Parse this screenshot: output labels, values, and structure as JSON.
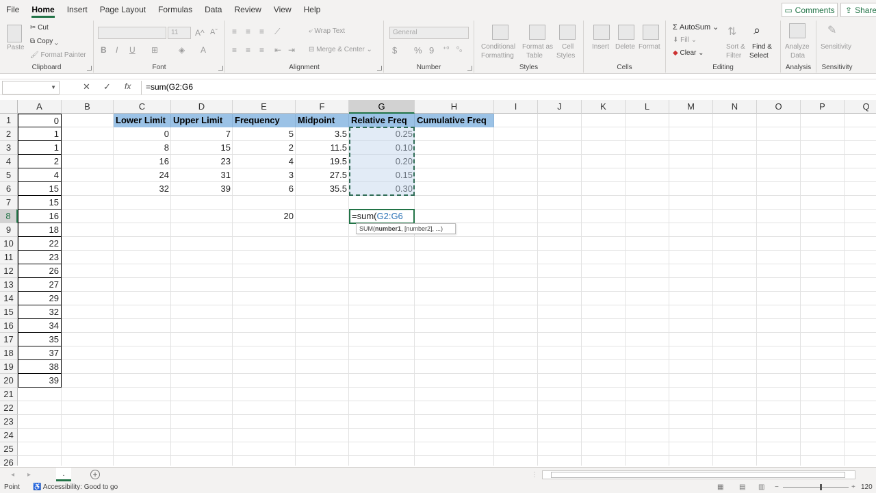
{
  "menu": {
    "tabs": [
      "File",
      "Home",
      "Insert",
      "Page Layout",
      "Formulas",
      "Data",
      "Review",
      "View",
      "Help"
    ],
    "active": "Home",
    "comments_label": "Comments",
    "share_label": "Share"
  },
  "ribbon": {
    "clipboard": {
      "label": "Clipboard",
      "paste": "Paste",
      "cut": "Cut",
      "copy": "Copy",
      "format_painter": "Format Painter"
    },
    "font": {
      "label": "Font",
      "size": "11",
      "bold": "B",
      "italic": "I",
      "underline": "U"
    },
    "alignment": {
      "label": "Alignment",
      "wrap": "Wrap Text",
      "merge": "Merge & Center"
    },
    "number": {
      "label": "Number",
      "format": "General",
      "currency": "$",
      "percent": "%",
      "comma": "9"
    },
    "styles": {
      "label": "Styles",
      "conditional": "Conditional",
      "formatting": "Formatting",
      "format_as": "Format as",
      "table": "Table",
      "cell": "Cell",
      "cell_styles": "Styles"
    },
    "cells": {
      "label": "Cells",
      "insert": "Insert",
      "delete": "Delete",
      "format": "Format"
    },
    "editing": {
      "label": "Editing",
      "autosum": "AutoSum",
      "fill": "Fill",
      "clear": "Clear",
      "sort": "Sort &",
      "filter": "Filter",
      "find": "Find &",
      "select": "Select"
    },
    "analysis": {
      "label": "Analysis",
      "analyze": "Analyze",
      "data": "Data"
    },
    "sensitivity": {
      "label": "Sensitivity",
      "name": "Sensitivity"
    }
  },
  "formula_bar": {
    "cancel": "✕",
    "enter": "✓",
    "fx": "fx",
    "content": "=sum(G2:G6"
  },
  "columns": [
    "A",
    "B",
    "C",
    "D",
    "E",
    "F",
    "G",
    "H",
    "I",
    "J",
    "K",
    "L",
    "M",
    "N",
    "O",
    "P",
    "Q"
  ],
  "rows": [
    "1",
    "2",
    "3",
    "4",
    "5",
    "6",
    "7",
    "8",
    "9",
    "10",
    "11",
    "12",
    "13",
    "14",
    "15",
    "16",
    "17",
    "18",
    "19",
    "20",
    "21",
    "22",
    "23",
    "24",
    "25",
    "26"
  ],
  "col_a": [
    "0",
    "1",
    "1",
    "2",
    "4",
    "15",
    "15",
    "16",
    "18",
    "22",
    "23",
    "26",
    "27",
    "29",
    "32",
    "34",
    "35",
    "37",
    "38",
    "39"
  ],
  "table": {
    "headers": [
      "Lower Limit",
      "Upper Limit",
      "Frequency",
      "Midpoint",
      "Relative Freq",
      "Cumulative Freq"
    ],
    "rows": [
      [
        "0",
        "7",
        "5",
        "3.5",
        "0.25"
      ],
      [
        "8",
        "15",
        "2",
        "11.5",
        "0.10"
      ],
      [
        "16",
        "23",
        "4",
        "19.5",
        "0.20"
      ],
      [
        "24",
        "31",
        "3",
        "27.5",
        "0.15"
      ],
      [
        "32",
        "39",
        "6",
        "35.5",
        "0.30"
      ]
    ],
    "freq_total": "20"
  },
  "active_cell": {
    "prefix": "=sum(",
    "ref": "G2:G6"
  },
  "tooltip": {
    "fn": "SUM(",
    "arg1": "number1",
    "rest": ", [number2], ...)"
  },
  "sheet": {
    "tab": ".",
    "add": "+"
  },
  "status": {
    "mode": "Point",
    "accessibility": "Accessibility: Good to go",
    "zoom": "120"
  },
  "colors": {
    "accent": "#217346",
    "header_fill": "#9bc2e6"
  }
}
